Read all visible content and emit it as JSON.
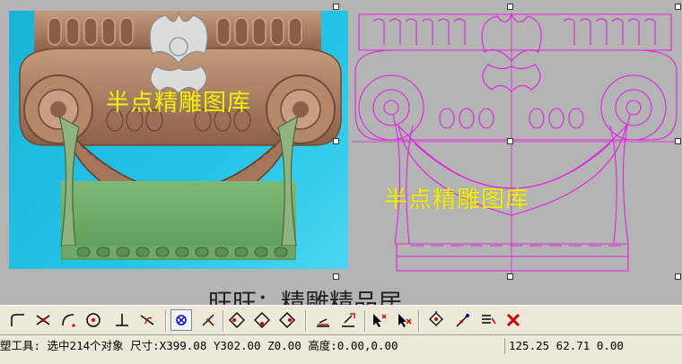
{
  "watermark": {
    "render_text": "半点精雕图库",
    "vector_text": "半点精雕图库",
    "shop_text": "旺旺：精雕精品居"
  },
  "colors": {
    "background": "#b4b4b4",
    "render_bg": "#27c3e6",
    "wood": "#a07458",
    "vector_line": "#e020e0",
    "watermark": "#f4f000"
  },
  "toolbar": {
    "icons": [
      "fillet-icon",
      "trim-icon",
      "arc-icon",
      "circle-target-icon",
      "perpendicular-icon",
      "tangent-icon",
      "snap-point-icon",
      "node-edit-icon",
      "mirror-left-icon",
      "mirror-center-icon",
      "mirror-right-icon",
      "align-bottom-icon",
      "align-top-icon",
      "select-add-icon",
      "select-remove-icon",
      "transform-icon",
      "arrange-icon",
      "list-edit-icon",
      "delete-icon"
    ]
  },
  "status": {
    "main": "塑工具: 选中214个对象 尺寸:X399.08 Y302.00 Z0.00 高度:0.00,0.00",
    "coords": "125.25 62.71 0.00"
  }
}
